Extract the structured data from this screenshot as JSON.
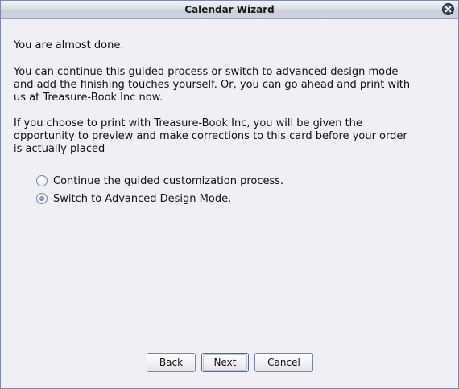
{
  "window": {
    "title": "Calendar Wizard"
  },
  "content": {
    "paragraph1": "You are almost done.",
    "paragraph2": "You can continue this guided process or switch to advanced design mode and add the finishing touches yourself. Or, you can go ahead and print with us at Treasure-Book Inc now.",
    "paragraph3": "If you choose to print with Treasure-Book Inc, you will be given the opportunity to preview and make corrections to this card before your order is actually placed"
  },
  "options": [
    {
      "label": "Continue the guided customization process.",
      "selected": false
    },
    {
      "label": "Switch to Advanced Design Mode.",
      "selected": true
    }
  ],
  "buttons": {
    "back": "Back",
    "next": "Next",
    "cancel": "Cancel"
  },
  "icons": {
    "close": "close-icon",
    "radio_unselected": "radio-unselected-icon",
    "radio_selected": "radio-selected-icon"
  }
}
